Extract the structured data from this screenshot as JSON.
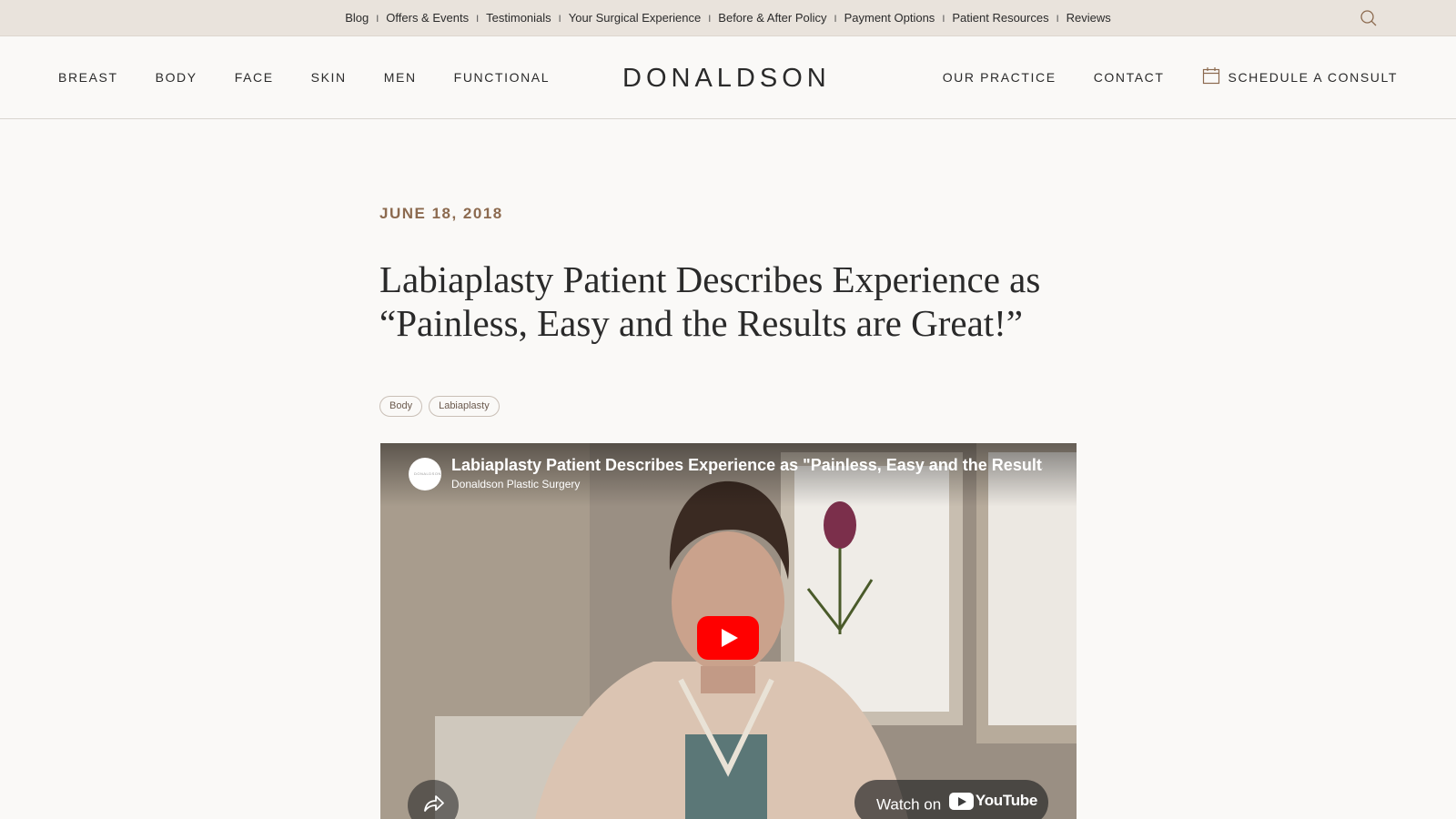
{
  "utility": {
    "links": [
      "Blog",
      "Offers & Events",
      "Testimonials",
      "Your Surgical Experience",
      "Before & After Policy",
      "Payment Options",
      "Patient Resources",
      "Reviews"
    ],
    "separator": "I",
    "search_icon": "search-icon"
  },
  "nav": {
    "left": [
      "BREAST",
      "BODY",
      "FACE",
      "SKIN",
      "MEN",
      "FUNCTIONAL"
    ],
    "logo": "DONALDSON",
    "right": {
      "practice": "OUR PRACTICE",
      "contact": "CONTACT",
      "consult": "SCHEDULE A CONSULT",
      "consult_icon": "calendar-icon"
    }
  },
  "article": {
    "date": "JUNE 18, 2018",
    "title": "Labiaplasty Patient Describes Experience as “Painless, Easy and the Results are Great!”",
    "tags": [
      "Body",
      "Labiaplasty"
    ]
  },
  "video": {
    "title": "Labiaplasty Patient Describes Experience as \"Painless, Easy and the Results are Great!\"",
    "channel": "Donaldson Plastic Surgery",
    "avatar_text": "DONALDSON",
    "watch_on": "Watch on",
    "youtube": "YouTube",
    "play_icon": "play-icon",
    "share_icon": "share-icon"
  },
  "colors": {
    "utility_bg": "#e9e3dc",
    "page_bg": "#faf9f7",
    "date_accent": "#8c6a4f",
    "play_red": "#ff0000"
  }
}
